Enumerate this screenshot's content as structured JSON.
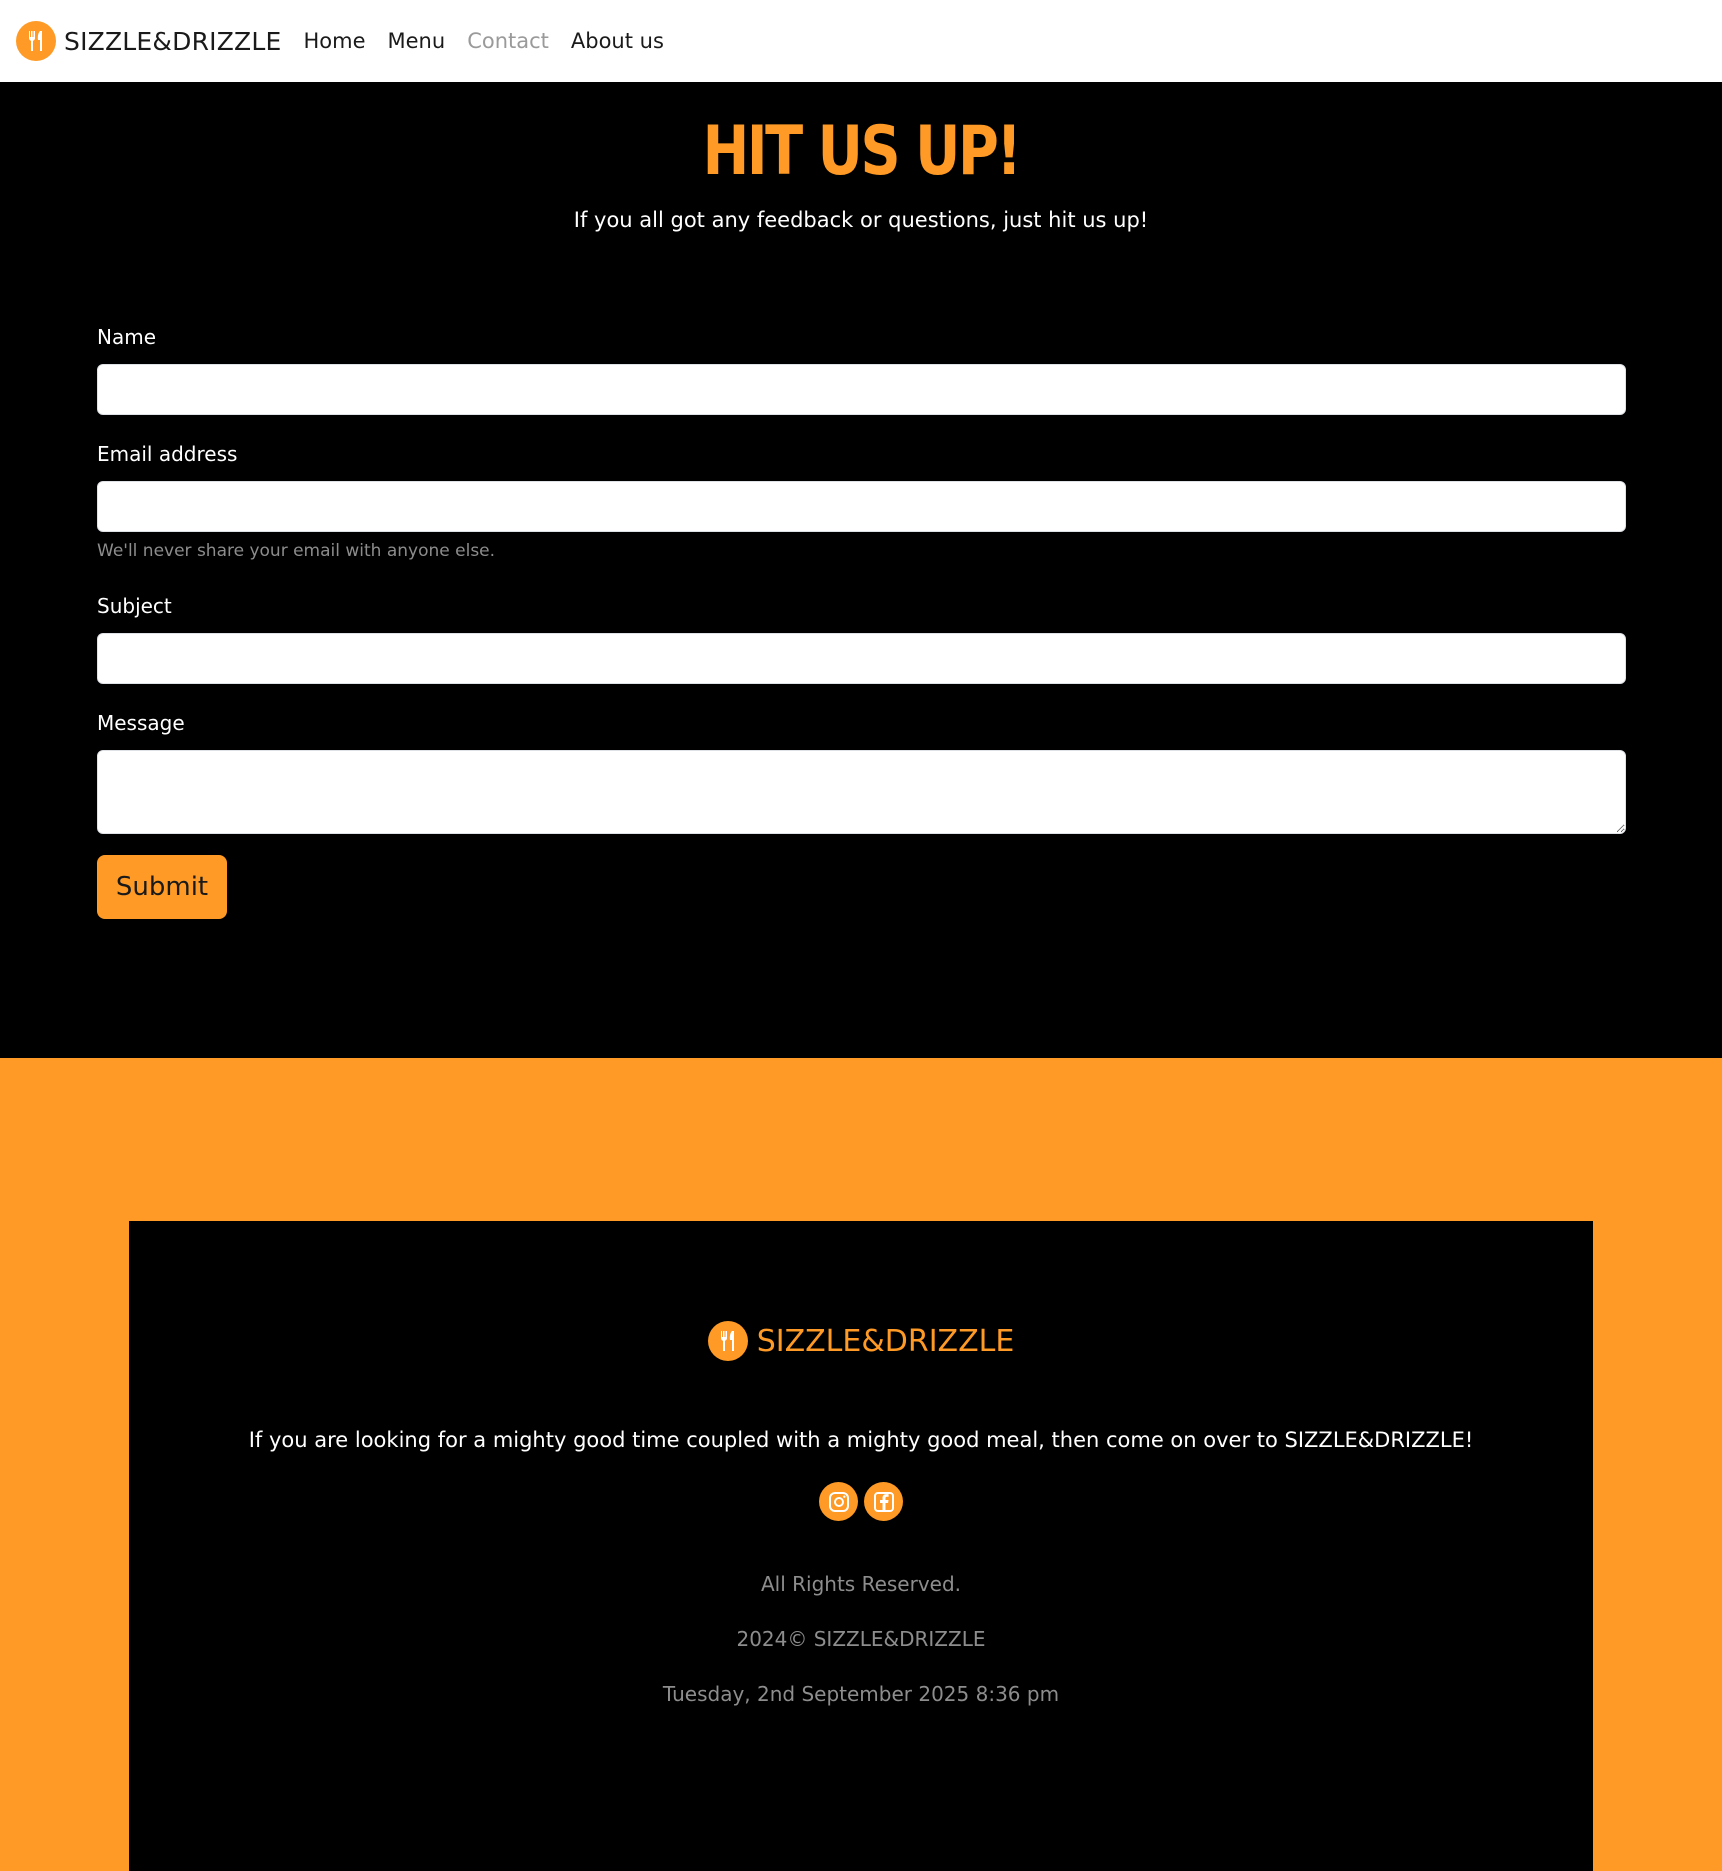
{
  "brand": {
    "name": "SIZZLE&DRIZZLE",
    "logo_icon": "fork-knife-icon",
    "accent_color": "#fe9a25"
  },
  "nav": {
    "items": [
      {
        "label": "Home",
        "active": false
      },
      {
        "label": "Menu",
        "active": false
      },
      {
        "label": "Contact",
        "active": true
      },
      {
        "label": "About us",
        "active": false
      }
    ]
  },
  "hero": {
    "title": "HIT US UP!",
    "subtitle": "If you all got any feedback or questions, just hit us up!"
  },
  "form": {
    "name_label": "Name",
    "name_value": "",
    "email_label": "Email address",
    "email_value": "",
    "email_hint": "We'll never share your email with anyone else.",
    "subject_label": "Subject",
    "subject_value": "",
    "message_label": "Message",
    "message_value": "",
    "submit_label": "Submit"
  },
  "footer": {
    "brand_name": "SIZZLE&DRIZZLE",
    "description": "If you are looking for a mighty good time coupled with a mighty good meal, then come on over to SIZZLE&DRIZZLE!",
    "socials": [
      {
        "icon": "instagram-icon"
      },
      {
        "icon": "facebook-icon"
      }
    ],
    "rights": "All Rights Reserved.",
    "copyright": "2024© SIZZLE&DRIZZLE",
    "datetime": "Tuesday, 2nd September 2025 8:36 pm"
  }
}
